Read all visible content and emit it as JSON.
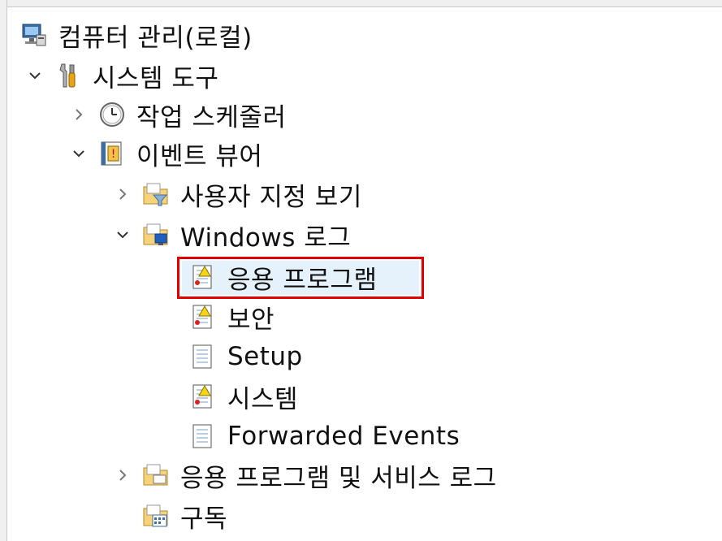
{
  "tree": {
    "root": {
      "label": "컴퓨터 관리(로컬)",
      "icon": "computer-management-icon"
    },
    "system_tools": {
      "label": "시스템 도구",
      "icon": "tools-icon"
    },
    "task_scheduler": {
      "label": "작업 스케줄러",
      "icon": "clock-icon"
    },
    "event_viewer": {
      "label": "이벤트 뷰어",
      "icon": "event-viewer-icon"
    },
    "custom_views": {
      "label": "사용자 지정 보기",
      "icon": "filter-folder-icon"
    },
    "windows_logs": {
      "label": "Windows 로그",
      "icon": "windows-folder-icon"
    },
    "logs": [
      {
        "label": "응용 프로그램",
        "icon": "warning-log-icon",
        "selected": true
      },
      {
        "label": "보안",
        "icon": "warning-log-icon"
      },
      {
        "label": "Setup",
        "icon": "log-icon"
      },
      {
        "label": "시스템",
        "icon": "warning-log-icon"
      },
      {
        "label": "Forwarded Events",
        "icon": "log-icon"
      }
    ],
    "app_service_logs": {
      "label": "응용 프로그램 및 서비스 로그",
      "icon": "folder-icon"
    },
    "subscriptions": {
      "label": "구독",
      "icon": "subscription-icon"
    }
  },
  "colors": {
    "highlight_border": "#e00000",
    "selection_bg": "#e5f1fb"
  }
}
